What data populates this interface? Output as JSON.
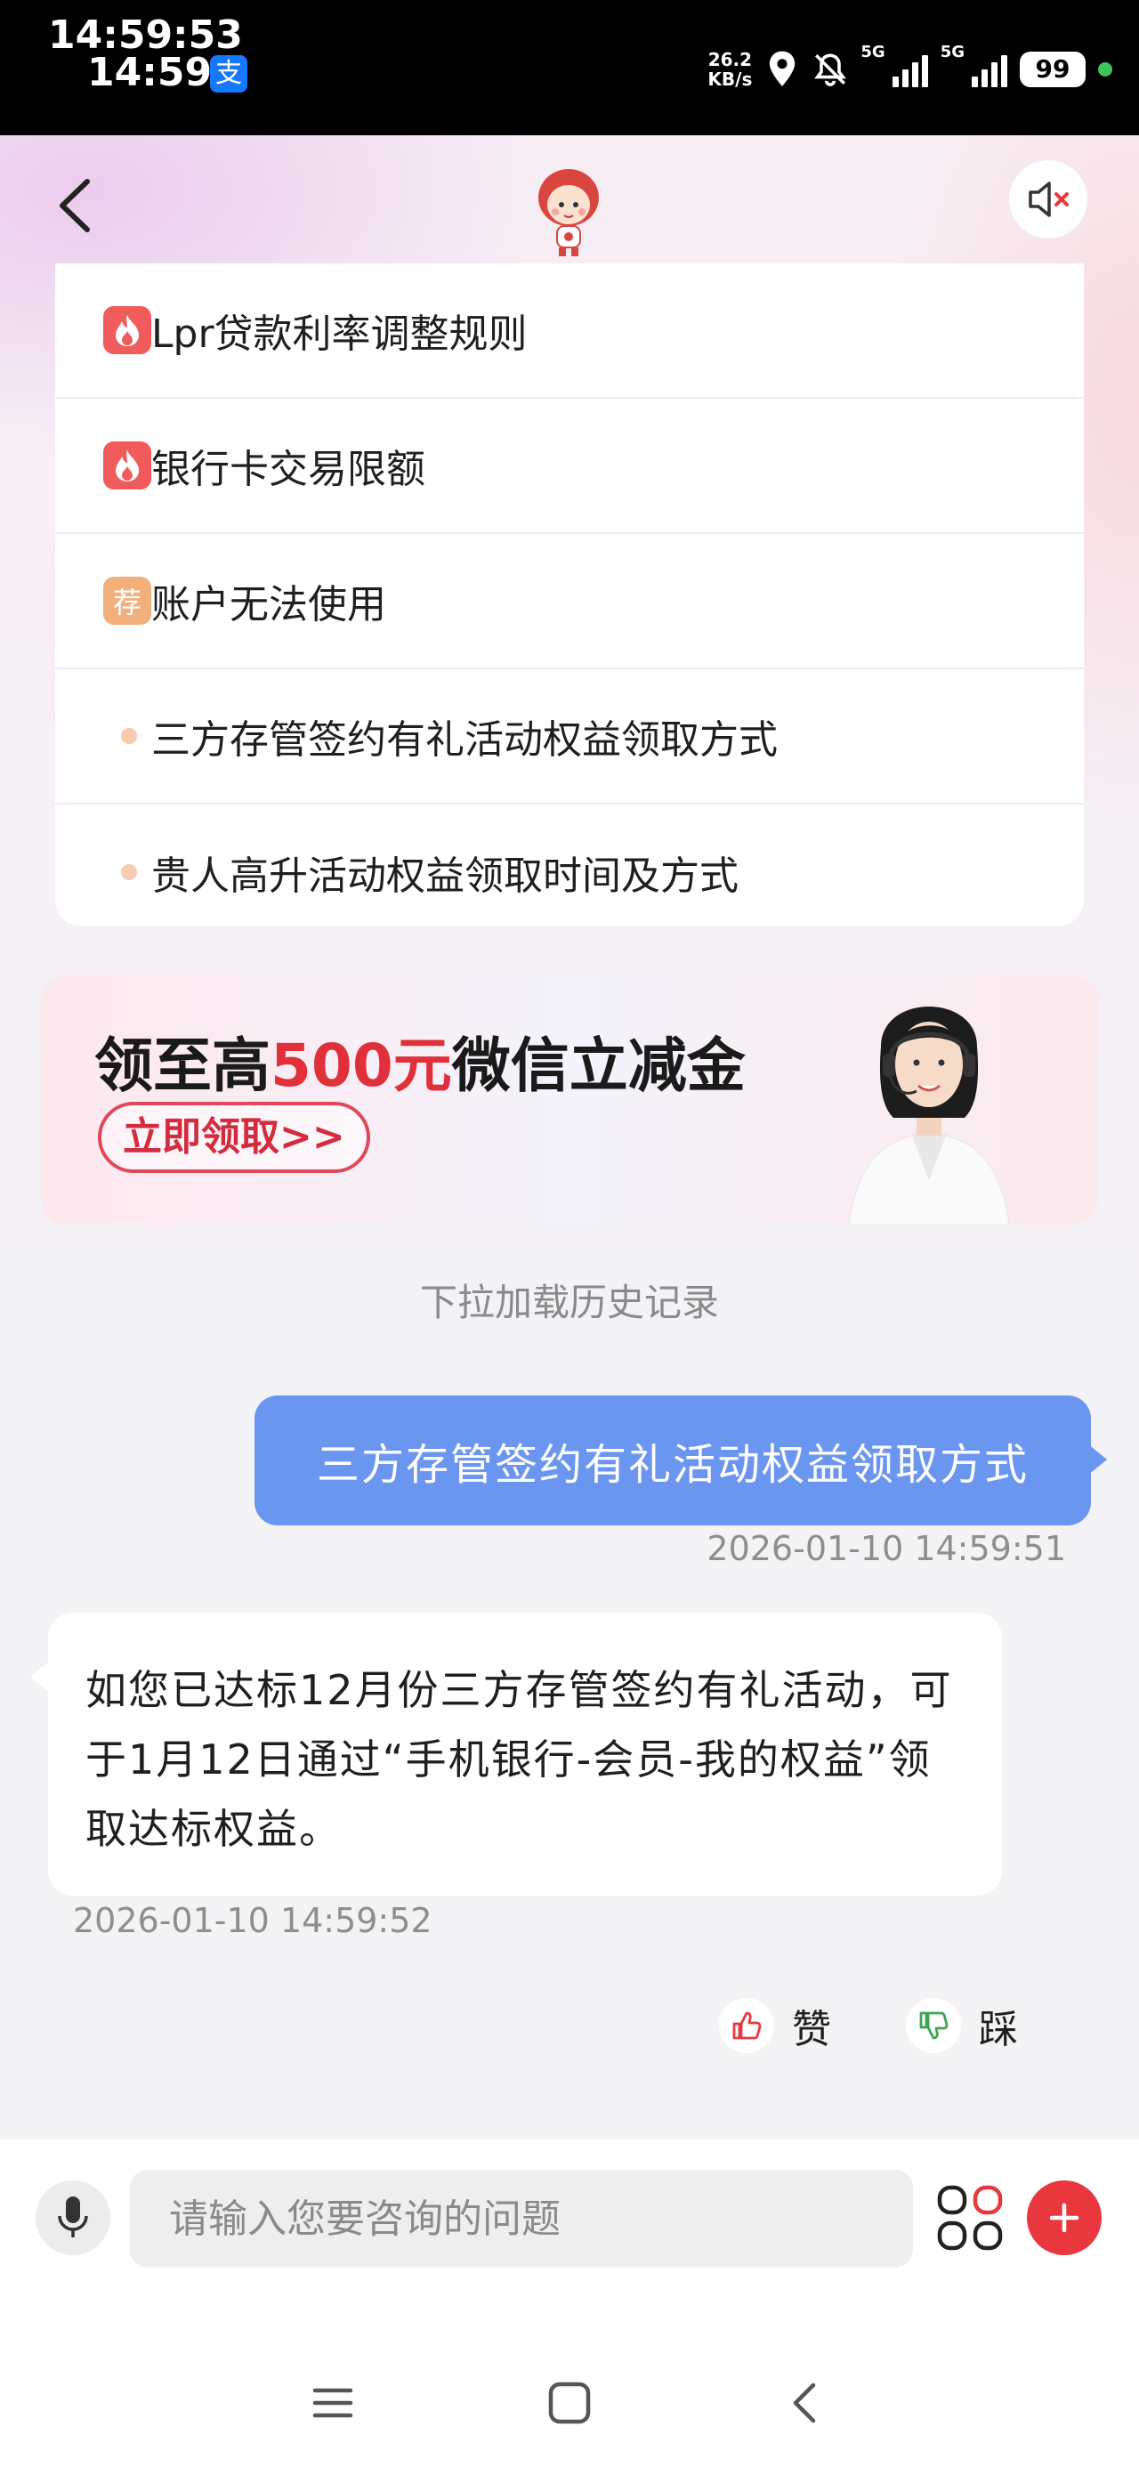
{
  "status_bar": {
    "time_large": "14:59:53",
    "time": "14:59",
    "alipay_glyph": "支",
    "net_speed_value": "26.2",
    "net_speed_unit": "KB/s",
    "sim1": "5G",
    "sim2": "5G",
    "battery": "99",
    "icons": [
      "location-icon",
      "bell-muted-icon",
      "signal-icon",
      "battery-icon"
    ]
  },
  "header": {
    "back_icon": "chevron-left-icon",
    "mascot": "mascot-avatar",
    "sound_icon": "speaker-muted-icon"
  },
  "faq": {
    "items": [
      {
        "badge": "hot",
        "label": "Lpr贷款利率调整规则"
      },
      {
        "badge": "hot",
        "label": "银行卡交易限额"
      },
      {
        "badge": "rec",
        "badge_text": "荐",
        "label": "账户无法使用"
      },
      {
        "badge": "dot",
        "label": "三方存管签约有礼活动权益领取方式"
      },
      {
        "badge": "dot",
        "label": "贵人高升活动权益领取时间及方式"
      }
    ]
  },
  "banner": {
    "title_prefix": "领至高",
    "title_amount": "500元",
    "title_suffix": "微信立减金",
    "button_label": "立即领取>>"
  },
  "chat": {
    "history_hint": "下拉加载历史记录",
    "user_message": "三方存管签约有礼活动权益领取方式",
    "user_time": "2026-01-10 14:59:51",
    "bot_message": "如您已达标12月份三方存管签约有礼活动，可于1月12日通过“手机银行-会员-我的权益”领取达标权益。",
    "bot_time": "2026-01-10 14:59:52",
    "like_label": "赞",
    "dislike_label": "踩"
  },
  "input_bar": {
    "placeholder": "请输入您要咨询的问题",
    "value": ""
  },
  "colors": {
    "accent_blue": "#6b96ef",
    "accent_red": "#e8383d",
    "hot_badge": "#f05b5b",
    "rec_badge": "#f2b07d"
  }
}
